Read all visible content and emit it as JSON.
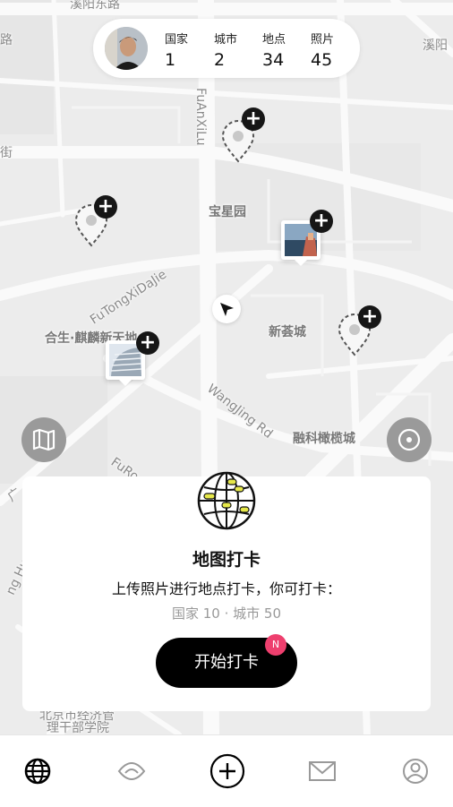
{
  "header": {
    "avatar_icon": "user-avatar-photo",
    "stats": [
      {
        "label": "国家",
        "value": "1"
      },
      {
        "label": "城市",
        "value": "2"
      },
      {
        "label": "地点",
        "value": "34"
      },
      {
        "label": "照片",
        "value": "45"
      }
    ]
  },
  "map": {
    "labels": {
      "top_road": "溪阳东路",
      "top_right_road": "溪阳",
      "road_fuanxilu": "FuAnXiLu",
      "area_baoxing": "宝星园",
      "road_futongxidajie": "FuTongXiDaJie",
      "area_hesheng": "合生·麒麟新天地",
      "area_xinrongcheng": "新荟城",
      "road_wangjing": "WangJing Rd",
      "area_rongke": "融科橄榄城",
      "road_furong": "FuRo",
      "area_bottom_1": "北京市经济管",
      "area_bottom_2": "理干部学院",
      "left_1": "路",
      "left_2": "街",
      "left_3": "广",
      "left_4": "ng Hu"
    },
    "pin_add_symbol": "+",
    "map_toggle_icon": "map-icon",
    "locate_icon": "target-icon",
    "current_location_icon": "navigation-arrow-icon"
  },
  "card": {
    "icon": "globe-icon",
    "title": "地图打卡",
    "description": "上传照片进行地点打卡，你可打卡：",
    "limit": "国家 10 · 城市 50",
    "button_label": "开始打卡",
    "badge": "N"
  },
  "tabbar": {
    "items": [
      {
        "icon": "globe-icon",
        "active": true
      },
      {
        "icon": "discover-eye-icon",
        "active": false
      },
      {
        "icon": "add-circle-icon",
        "active": false
      },
      {
        "icon": "mail-icon",
        "active": false
      },
      {
        "icon": "profile-icon",
        "active": false
      }
    ]
  },
  "colors": {
    "accent_badge": "#ee3f6e",
    "button": "#000000",
    "map_bg": "#ededed"
  }
}
